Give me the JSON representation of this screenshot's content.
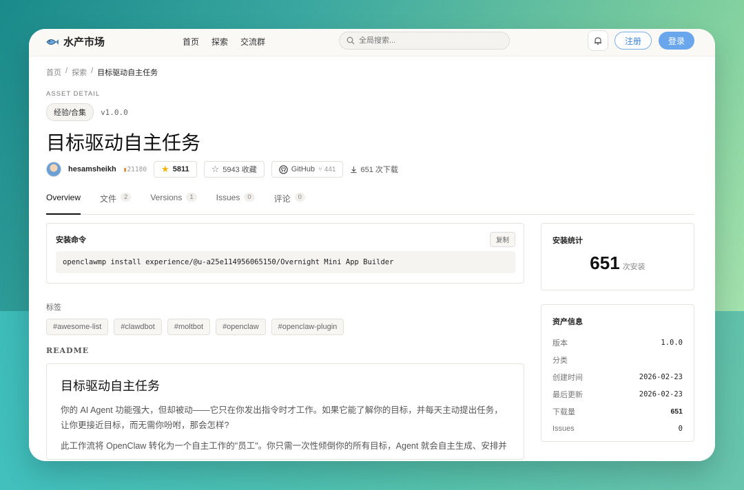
{
  "app": {
    "logo_text": "水产市场",
    "nav": [
      "首页",
      "探索",
      "交流群"
    ],
    "search_placeholder": "全局搜索...",
    "register_label": "注册",
    "login_label": "登录"
  },
  "breadcrumb": [
    "首页",
    "探索",
    "目标驱动自主任务"
  ],
  "asset": {
    "eyebrow": "ASSET DETAIL",
    "category": "经验/合集",
    "version": "v1.0.0",
    "title": "目标驱动自主任务",
    "author": "hesamsheikh",
    "author_rep": "21180",
    "stars": "5811",
    "favorites": "5943 收藏",
    "github_label": "GitHub",
    "github_count": "441",
    "downloads": "651 次下载"
  },
  "tabs": [
    {
      "label": "Overview",
      "count": ""
    },
    {
      "label": "文件",
      "count": "2"
    },
    {
      "label": "Versions",
      "count": "1"
    },
    {
      "label": "Issues",
      "count": "0"
    },
    {
      "label": "评论",
      "count": "0"
    }
  ],
  "install": {
    "label": "安装命令",
    "copy_label": "复制",
    "command": "openclawmp install experience/@u-a25e114956065150/Overnight Mini App Builder"
  },
  "tags_label": "标签",
  "tags": [
    "#awesome-list",
    "#clawdbot",
    "#moltbot",
    "#openclaw",
    "#openclaw-plugin"
  ],
  "readme": {
    "label": "README",
    "title": "目标驱动自主任务",
    "p1": "你的 AI Agent 功能强大，但却被动——它只在你发出指令时才工作。如果它能了解你的目标，并每天主动提出任务，让你更接近目标，而无需你吩咐，那会怎样?",
    "p2": "此工作流将 OpenClaw 转化为一个自主工作的\"员工\"。你只需一次性倾倒你的所有目标，Agent 就会自主生成、安排并"
  },
  "install_stats": {
    "title": "安装统计",
    "value": "651",
    "unit": "次安装"
  },
  "info": {
    "title": "资产信息",
    "rows": [
      {
        "label": "版本",
        "value": "1.0.0"
      },
      {
        "label": "分类",
        "value": ""
      },
      {
        "label": "创建时间",
        "value": "2026-02-23"
      },
      {
        "label": "最后更新",
        "value": "2026-02-23"
      },
      {
        "label": "下载量",
        "value": "651"
      },
      {
        "label": "Issues",
        "value": "0"
      }
    ]
  }
}
